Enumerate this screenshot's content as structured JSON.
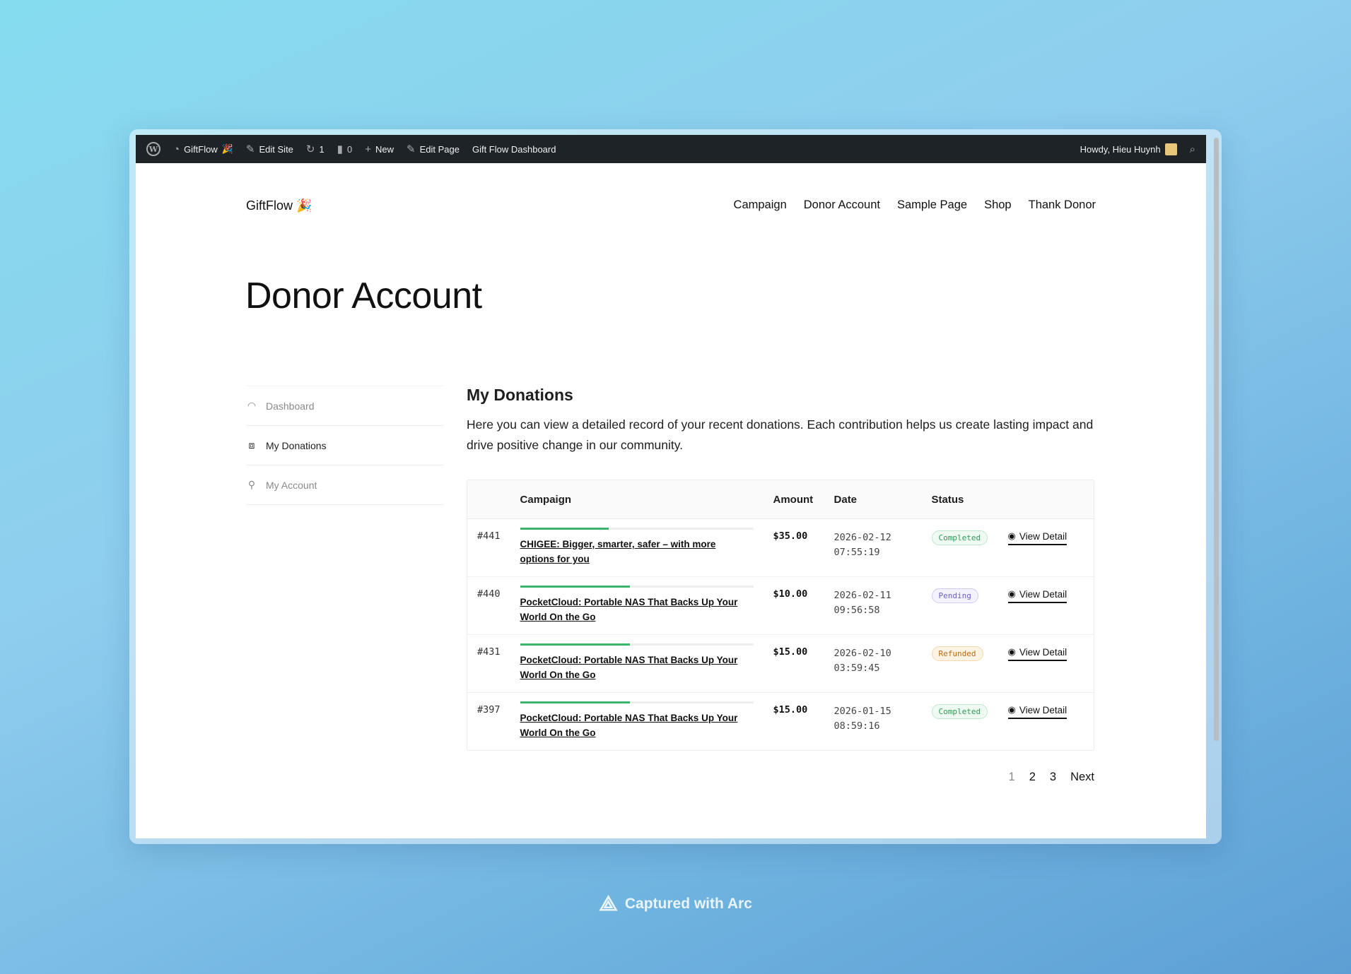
{
  "admin_bar": {
    "site_name": "GiftFlow",
    "edit_site": "Edit Site",
    "updates_count": "1",
    "comments_count": "0",
    "new_label": "New",
    "edit_page": "Edit Page",
    "dashboard_link": "Gift Flow Dashboard",
    "howdy": "Howdy, Hieu Huynh"
  },
  "site": {
    "title": "GiftFlow",
    "nav": [
      "Campaign",
      "Donor Account",
      "Sample Page",
      "Shop",
      "Thank Donor"
    ]
  },
  "page": {
    "title": "Donor Account"
  },
  "sidebar": {
    "items": [
      {
        "label": "Dashboard",
        "icon": "gauge-icon"
      },
      {
        "label": "My Donations",
        "icon": "donation-box-icon",
        "active": true
      },
      {
        "label": "My Account",
        "icon": "user-icon"
      }
    ]
  },
  "main": {
    "heading": "My Donations",
    "intro": "Here you can view a detailed record of your recent donations. Each contribution helps us create lasting impact and drive positive change in our community.",
    "columns": [
      "Campaign",
      "Amount",
      "Date",
      "Status"
    ],
    "rows": [
      {
        "id": "#441",
        "campaign": "CHIGEE: Bigger, smarter, safer – with more options for you",
        "progress": 0.38,
        "amount": "$35.00",
        "date": "2026-02-12",
        "time": "07:55:19",
        "status": "Completed",
        "status_key": "completed",
        "action": "View Detail"
      },
      {
        "id": "#440",
        "campaign": "PocketCloud: Portable NAS That Backs Up Your World On the Go",
        "progress": 0.47,
        "amount": "$10.00",
        "date": "2026-02-11",
        "time": "09:56:58",
        "status": "Pending",
        "status_key": "pending",
        "action": "View Detail"
      },
      {
        "id": "#431",
        "campaign": "PocketCloud: Portable NAS That Backs Up Your World On the Go",
        "progress": 0.47,
        "amount": "$15.00",
        "date": "2026-02-10",
        "time": "03:59:45",
        "status": "Refunded",
        "status_key": "refunded",
        "action": "View Detail"
      },
      {
        "id": "#397",
        "campaign": "PocketCloud: Portable NAS That Backs Up Your World On the Go",
        "progress": 0.47,
        "amount": "$15.00",
        "date": "2026-01-15",
        "time": "08:59:16",
        "status": "Completed",
        "status_key": "completed",
        "action": "View Detail"
      }
    ],
    "pagination": {
      "pages": [
        "1",
        "2",
        "3"
      ],
      "current": "1",
      "next": "Next"
    }
  },
  "footer": {
    "capture_text": "Captured with Arc"
  },
  "colors": {
    "admin_bar": "#1d2327",
    "progress": "#3bb56b",
    "completed": "#2e9a55",
    "pending": "#6b61c9",
    "refunded": "#b86a12"
  }
}
